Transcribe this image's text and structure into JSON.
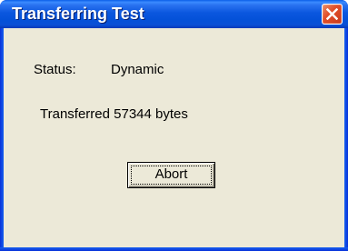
{
  "window": {
    "title": "Transferring Test",
    "close_icon": "close-icon",
    "colors": {
      "titlebar": "#0b57df",
      "close_button": "#e2502b",
      "client_background": "#ece9d8"
    }
  },
  "status": {
    "label": "Status:",
    "value": "Dynamic"
  },
  "transfer": {
    "message": "Transferred 57344 bytes"
  },
  "actions": {
    "abort_label": "Abort"
  }
}
